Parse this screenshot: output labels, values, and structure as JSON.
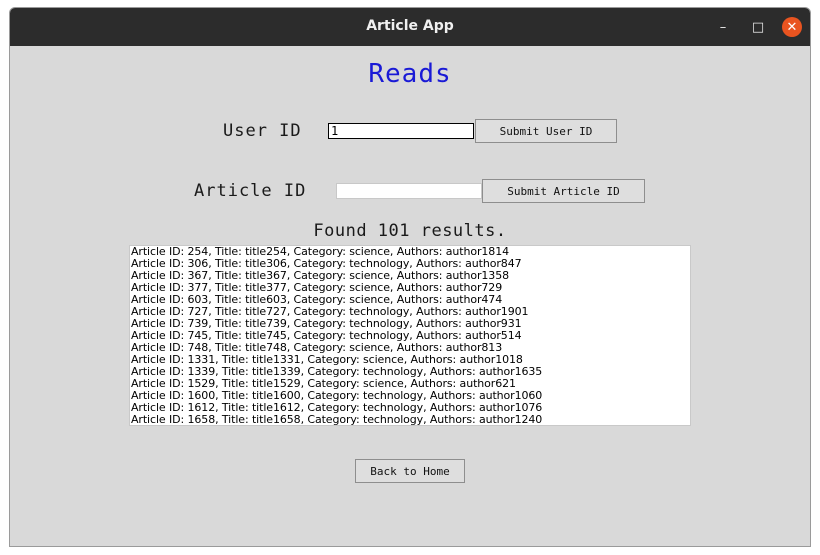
{
  "window": {
    "title": "Article App",
    "controls": {
      "minimize_glyph": "–",
      "maximize_glyph": "□",
      "close_glyph": "✕"
    }
  },
  "heading": "Reads",
  "user_id": {
    "label": "User ID",
    "value": "1",
    "button": "Submit User ID"
  },
  "article_id": {
    "label": "Article ID",
    "value": "",
    "button": "Submit Article ID"
  },
  "results": {
    "summary": "Found 101 results.",
    "rows": [
      "Article ID: 254, Title: title254, Category: science, Authors: author1814",
      "Article ID: 306, Title: title306, Category: technology, Authors: author847",
      "Article ID: 367, Title: title367, Category: science, Authors: author1358",
      "Article ID: 377, Title: title377, Category: science, Authors: author729",
      "Article ID: 603, Title: title603, Category: science, Authors: author474",
      "Article ID: 727, Title: title727, Category: technology, Authors: author1901",
      "Article ID: 739, Title: title739, Category: technology, Authors: author931",
      "Article ID: 745, Title: title745, Category: technology, Authors: author514",
      "Article ID: 748, Title: title748, Category: science, Authors: author813",
      "Article ID: 1331, Title: title1331, Category: science, Authors: author1018",
      "Article ID: 1339, Title: title1339, Category: technology, Authors: author1635",
      "Article ID: 1529, Title: title1529, Category: science, Authors: author621",
      "Article ID: 1600, Title: title1600, Category: technology, Authors: author1060",
      "Article ID: 1612, Title: title1612, Category: technology, Authors: author1076",
      "Article ID: 1658, Title: title1658, Category: technology, Authors: author1240"
    ]
  },
  "back_button": "Back to Home",
  "colors": {
    "heading": "#1a1ad6",
    "titlebar": "#2c2c2c",
    "close_button": "#e95420",
    "window_bg": "#d9d9d9"
  }
}
